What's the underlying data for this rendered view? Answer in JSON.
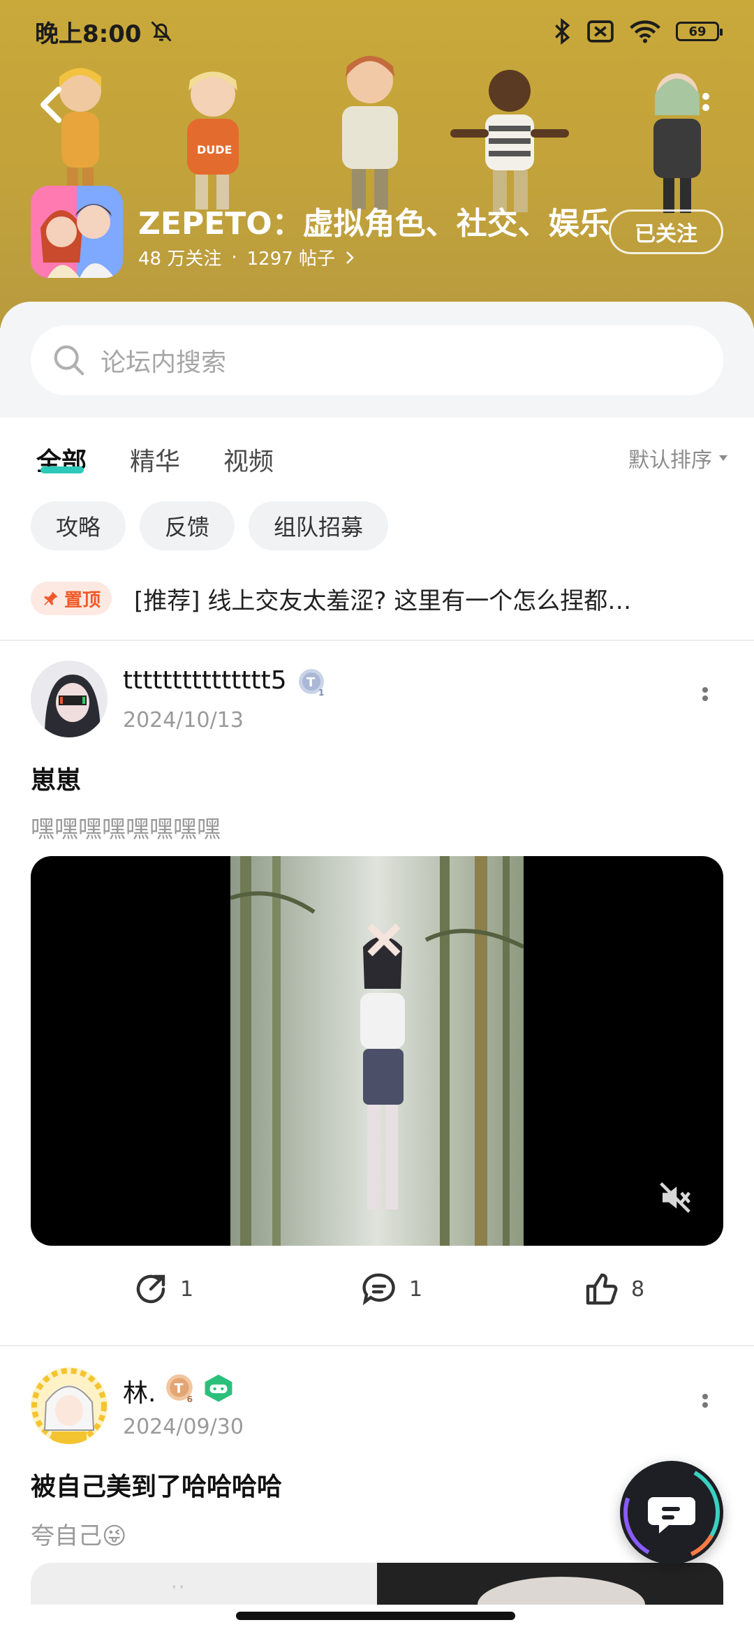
{
  "status_bar": {
    "time": "晚上8:00",
    "battery": "69"
  },
  "forum": {
    "title": "ZEPETO：虚拟角色、社交、娱乐",
    "followers": "48 万关注",
    "separator": "·",
    "posts": "1297 帖子",
    "follow_label": "已关注"
  },
  "search": {
    "placeholder": "论坛内搜索"
  },
  "tabs": [
    {
      "label": "全部"
    },
    {
      "label": "精华"
    },
    {
      "label": "视频"
    }
  ],
  "sort_label": "默认排序",
  "chips": [
    "攻略",
    "反馈",
    "组队招募"
  ],
  "pinned": {
    "badge": "置顶",
    "text": "[推荐] 线上交友太羞涩? 这里有一个怎么捏都…"
  },
  "posts": [
    {
      "username": "ttttttttttttttt5",
      "level": "1",
      "date": "2024/10/13",
      "title": "崽崽",
      "body": "嘿嘿嘿嘿嘿嘿嘿嘿",
      "shares": "1",
      "comments": "1",
      "likes": "8"
    },
    {
      "username": "林.",
      "level": "6",
      "date": "2024/09/30",
      "title": "被自己美到了哈哈哈哈",
      "body": "夸自己😜"
    }
  ],
  "icons": {
    "back": "chevron-left-icon",
    "more": "more-vertical-icon",
    "search": "search-icon",
    "pin": "pin-icon",
    "mute": "volume-mute-icon",
    "share": "share-icon",
    "comment": "comment-icon",
    "like": "thumbs-up-icon",
    "fab": "chat-bubble-icon"
  },
  "colors": {
    "header": "#c4a43a",
    "accent": "#2cc9b8",
    "pin": "#f05a2a"
  }
}
